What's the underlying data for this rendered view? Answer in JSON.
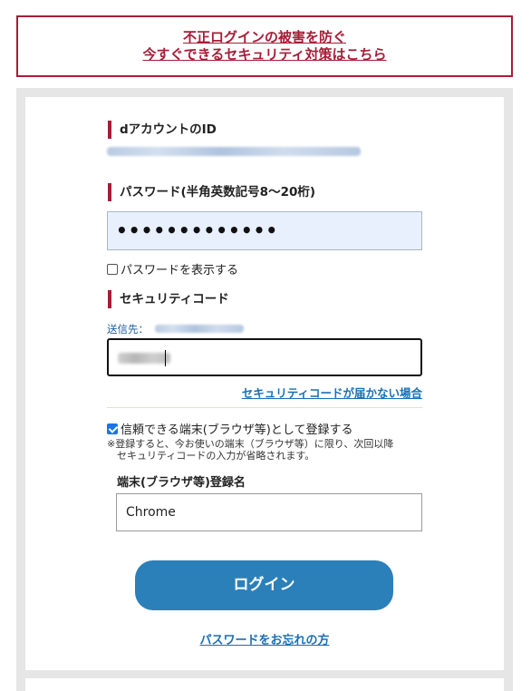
{
  "banner": {
    "line1": "不正ログインの被害を防ぐ",
    "line2": "今すぐできるセキュリティ対策はこちら"
  },
  "account": {
    "id_heading": "dアカウントのID"
  },
  "password": {
    "heading": "パスワード(半角英数記号8～20桁)",
    "masked_value": "•••••••••••••",
    "show_label": "パスワードを表示する",
    "show_checked": false
  },
  "security_code": {
    "heading": "セキュリティコード",
    "sent_to_label": "送信先：",
    "not_received_link": "セキュリティコードが届かない場合"
  },
  "trusted_device": {
    "label": "信頼できる端末(ブラウザ等)として登録する",
    "checked": true,
    "note_line1": "※登録すると、今お使いの端末（ブラウザ等）に限り、次回以降",
    "note_line2": "セキュリティコードの入力が省略されます。",
    "name_label": "端末(ブラウザ等)登録名",
    "name_value": "Chrome"
  },
  "actions": {
    "login_label": "ログイン",
    "forgot_label": "パスワードをお忘れの方"
  },
  "colors": {
    "brand": "#a61d37",
    "button": "#2b80b9",
    "link": "#1a6fb5",
    "autofill_bg": "#e8f0fe"
  }
}
